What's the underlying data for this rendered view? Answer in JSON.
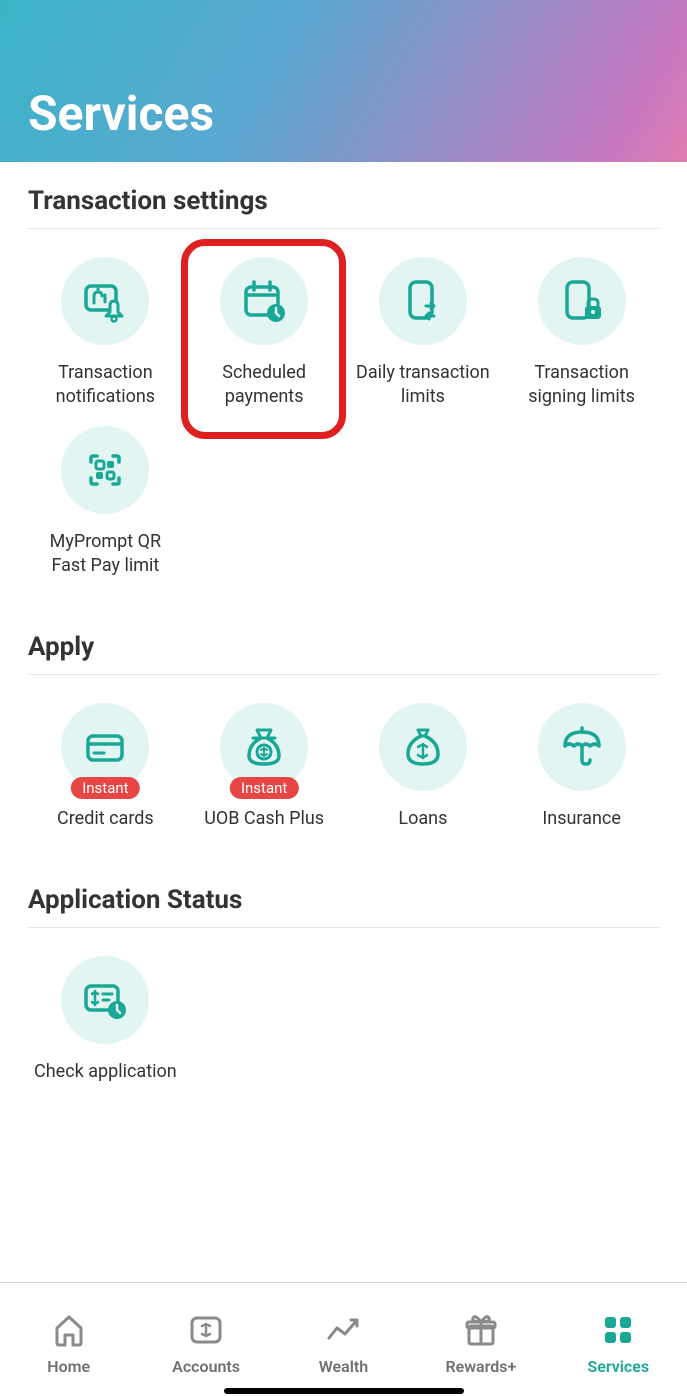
{
  "header": {
    "title": "Services"
  },
  "sections": {
    "transaction": {
      "title": "Transaction settings",
      "items": [
        {
          "label": "Transaction notifications"
        },
        {
          "label": "Scheduled payments"
        },
        {
          "label": "Daily transaction limits"
        },
        {
          "label": "Transaction signing limits"
        },
        {
          "label": "MyPrompt QR Fast Pay limit"
        }
      ]
    },
    "apply": {
      "title": "Apply",
      "badge": "Instant",
      "items": [
        {
          "label": "Credit cards"
        },
        {
          "label": "UOB Cash Plus"
        },
        {
          "label": "Loans"
        },
        {
          "label": "Insurance"
        }
      ]
    },
    "status": {
      "title": "Application Status",
      "items": [
        {
          "label": "Check application"
        }
      ]
    }
  },
  "nav": {
    "home": "Home",
    "accounts": "Accounts",
    "wealth": "Wealth",
    "rewards": "Rewards+",
    "services": "Services"
  },
  "colors": {
    "teal": "#1aa896",
    "lightTeal": "#e2f5f2",
    "red": "#e84545",
    "highlight": "#e02020"
  }
}
